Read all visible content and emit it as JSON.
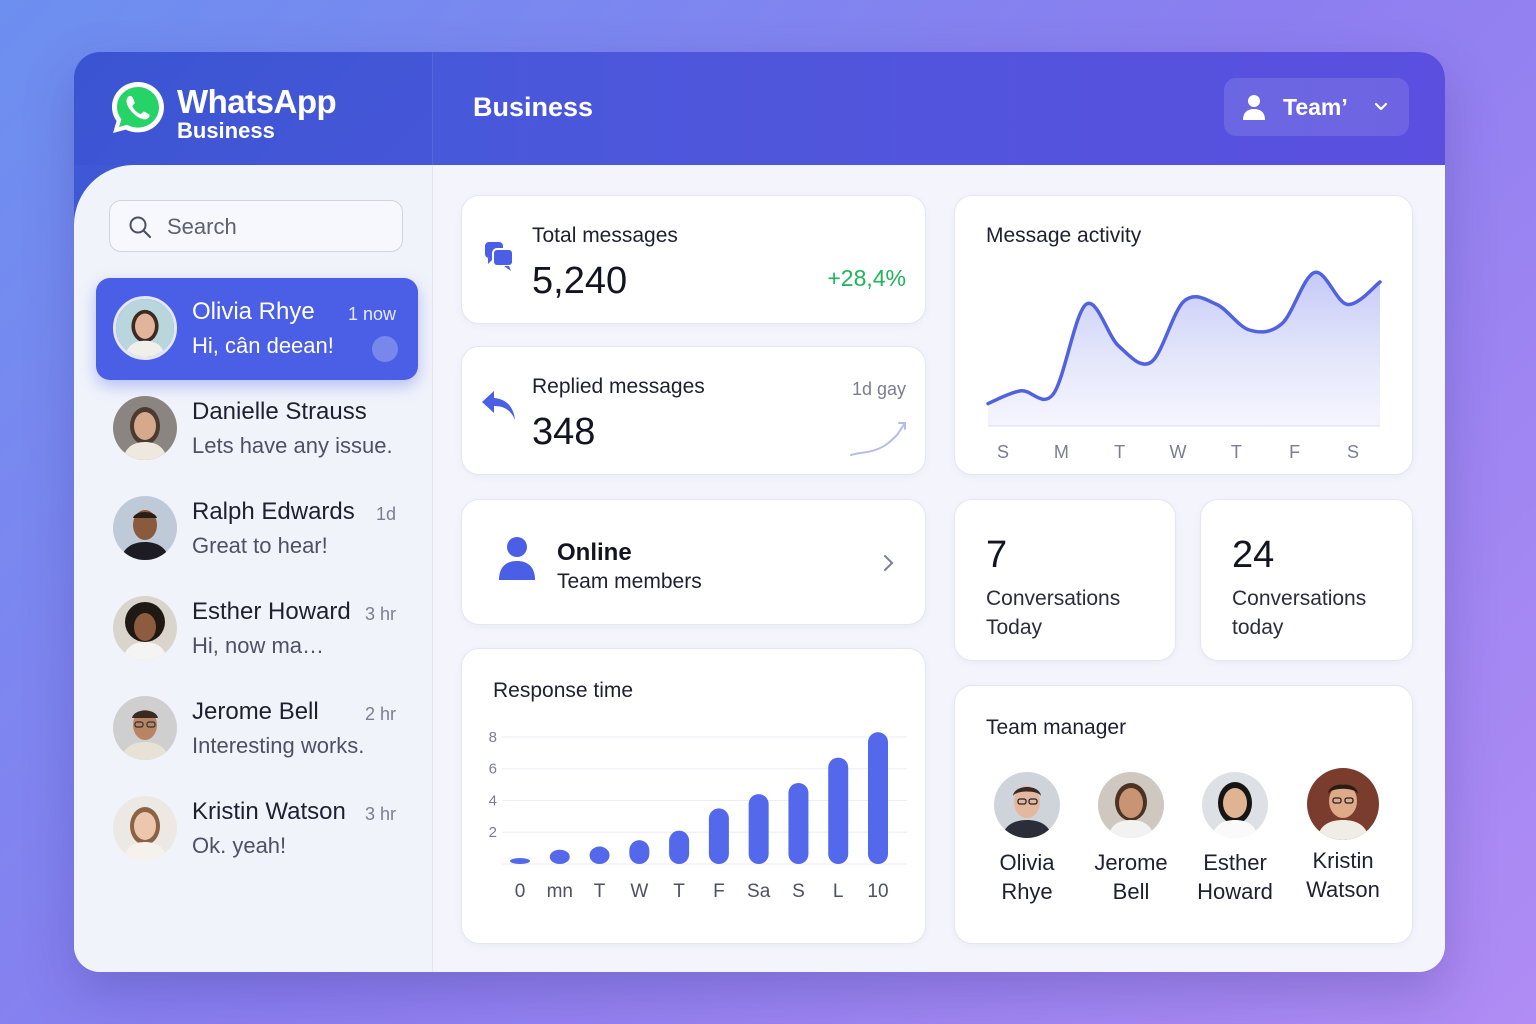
{
  "brand": {
    "name": "WhatsApp",
    "sub": "Business"
  },
  "header": {
    "title": "Business",
    "team_label": "Teamʼ"
  },
  "search": {
    "placeholder": "Search"
  },
  "chats": [
    {
      "name": "Olivia Rhye",
      "message": "Hi, cân deean!",
      "time": "1 now",
      "active": true
    },
    {
      "name": "Danielle Strauss",
      "message": "Lets have any issue.",
      "time": ""
    },
    {
      "name": "Ralph Edwards",
      "message": "Great to hear!",
      "time": "1d"
    },
    {
      "name": "Esther Howard",
      "message": "Hi, now ma…",
      "time": "3 hr"
    },
    {
      "name": "Jerome Bell",
      "message": "Interesting works.",
      "time": "2 hr"
    },
    {
      "name": "Kristin Watson",
      "message": "Ok. yeah!",
      "time": "3 hr"
    }
  ],
  "stats": {
    "total": {
      "label": "Total messages",
      "value": "5,240",
      "change": "+28,4%"
    },
    "replied": {
      "label": "Replied messages",
      "value": "348",
      "period": "1d gay"
    },
    "online": {
      "title": "Online",
      "subtitle": "Team members"
    },
    "conv_a": {
      "value": "7",
      "label": "Conversations Today"
    },
    "conv_b": {
      "value": "24",
      "label": "Conversations today"
    }
  },
  "activity": {
    "title": "Message activity",
    "days": [
      "S",
      "M",
      "T",
      "W",
      "T",
      "F",
      "S"
    ]
  },
  "response": {
    "title": "Response time"
  },
  "team_manager": {
    "title": "Team manager",
    "members": [
      {
        "first": "Olivia",
        "last": "Rhye"
      },
      {
        "first": "Jerome",
        "last": "Bell"
      },
      {
        "first": "Esther",
        "last": "Howard"
      },
      {
        "first": "Kristin",
        "last": "Watson"
      }
    ]
  },
  "colors": {
    "accent": "#4a5fe6",
    "header": "#4f56dc",
    "positive": "#1fb35a",
    "whatsapp_green": "#25d366"
  },
  "chart_data": [
    {
      "type": "area",
      "title": "Message activity",
      "categories": [
        "S",
        "M",
        "T",
        "W",
        "T",
        "F",
        "S"
      ],
      "x": [
        0,
        0.5,
        1,
        1.5,
        2,
        2.5,
        3,
        3.5,
        4,
        4.5,
        5,
        5.5,
        6
      ],
      "values": [
        0.7,
        1.1,
        1.0,
        3.8,
        2.5,
        2.0,
        3.9,
        3.8,
        3.0,
        3.2,
        4.8,
        3.8,
        4.5
      ],
      "ylim": [
        0,
        5
      ],
      "grid": false,
      "note_axis": "no y tick labels shown"
    },
    {
      "type": "bar",
      "title": "Response time",
      "categories": [
        "0",
        "mn",
        "T",
        "W",
        "T",
        "F",
        "Sa",
        "S",
        "L",
        "10"
      ],
      "values": [
        0.2,
        0.9,
        1.1,
        1.5,
        2.1,
        3.5,
        4.4,
        5.1,
        6.7,
        8.3
      ],
      "yticks": [
        2,
        4,
        6,
        8
      ],
      "ylim": [
        0,
        8.5
      ],
      "grid": true
    }
  ]
}
